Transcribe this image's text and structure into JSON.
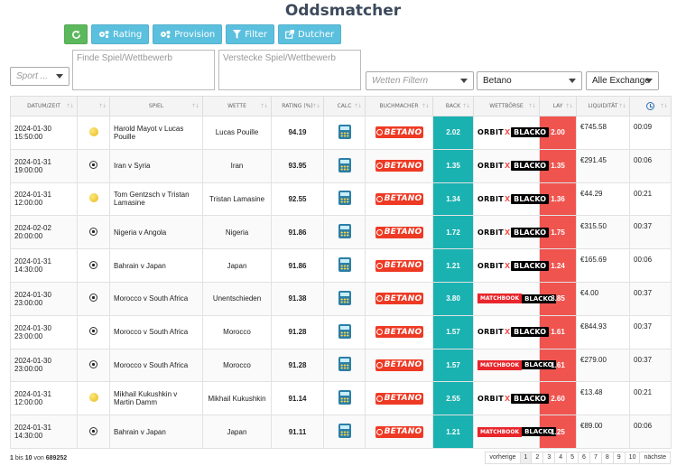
{
  "title": "Oddsmatcher",
  "toolbar": {
    "refresh_icon": "refresh-icon",
    "rating_label": "Rating",
    "provision_label": "Provision",
    "filter_label": "Filter",
    "dutcher_label": "Dutcher"
  },
  "filters": {
    "sport_placeholder": "Sport ...",
    "find_placeholder": "Finde Spiel/Wettbewerb",
    "hide_placeholder": "Verstecke Spiel/Wettbewerb",
    "bets_placeholder": "Wetten Filtern",
    "bookmaker_value": "Betano",
    "exchange_value": "Alle Exchange"
  },
  "table": {
    "headers": {
      "datetime": "Datum/Zeit",
      "spiel": "Spiel",
      "wette": "Wette",
      "rating": "Rating (%)",
      "calc": "Calc",
      "buchmacher": "Buchmacher",
      "back": "Back",
      "wettborse": "Wettbörse",
      "lay": "Lay",
      "liquiditat": "Liquidität"
    },
    "rows": [
      {
        "date": "2024-01-30",
        "time": "15:50:00",
        "sport": "tennis",
        "spiel": "Harold Mayot v Lucas Pouille",
        "wette": "Lucas Pouille",
        "rating": "94.19",
        "bookmaker": "BETANO",
        "back": "2.02",
        "exchange": "orbit",
        "lay": "2.00",
        "liq": "€745.58",
        "age": "00:09"
      },
      {
        "date": "2024-01-31",
        "time": "19:00:00",
        "sport": "football",
        "spiel": "Iran v Syria",
        "wette": "Iran",
        "rating": "93.95",
        "bookmaker": "BETANO",
        "back": "1.35",
        "exchange": "orbit",
        "lay": "1.35",
        "liq": "€291.45",
        "age": "00:06"
      },
      {
        "date": "2024-01-31",
        "time": "12:00:00",
        "sport": "tennis",
        "spiel": "Tom Gentzsch v Tristan Lamasine",
        "wette": "Tristan Lamasine",
        "rating": "92.55",
        "bookmaker": "BETANO",
        "back": "1.34",
        "exchange": "orbit",
        "lay": "1.36",
        "liq": "€44.29",
        "age": "00:21"
      },
      {
        "date": "2024-02-02",
        "time": "20:00:00",
        "sport": "football",
        "spiel": "Nigeria v Angola",
        "wette": "Nigeria",
        "rating": "91.86",
        "bookmaker": "BETANO",
        "back": "1.72",
        "exchange": "orbit",
        "lay": "1.75",
        "liq": "€315.50",
        "age": "00:37"
      },
      {
        "date": "2024-01-31",
        "time": "14:30:00",
        "sport": "football",
        "spiel": "Bahrain v Japan",
        "wette": "Japan",
        "rating": "91.86",
        "bookmaker": "BETANO",
        "back": "1.21",
        "exchange": "orbit",
        "lay": "1.24",
        "liq": "€165.69",
        "age": "00:06"
      },
      {
        "date": "2024-01-30",
        "time": "23:00:00",
        "sport": "football",
        "spiel": "Morocco v South Africa",
        "wette": "Unentschieden",
        "rating": "91.38",
        "bookmaker": "BETANO",
        "back": "3.80",
        "exchange": "matchbook",
        "lay": "3.85",
        "liq": "€4.00",
        "age": "00:37"
      },
      {
        "date": "2024-01-30",
        "time": "23:00:00",
        "sport": "football",
        "spiel": "Morocco v South Africa",
        "wette": "Morocco",
        "rating": "91.28",
        "bookmaker": "BETANO",
        "back": "1.57",
        "exchange": "orbit",
        "lay": "1.61",
        "liq": "€844.93",
        "age": "00:37"
      },
      {
        "date": "2024-01-30",
        "time": "23:00:00",
        "sport": "football",
        "spiel": "Morocco v South Africa",
        "wette": "Morocco",
        "rating": "91.28",
        "bookmaker": "BETANO",
        "back": "1.57",
        "exchange": "matchbook",
        "lay": "1.61",
        "liq": "€279.00",
        "age": "00:37"
      },
      {
        "date": "2024-01-31",
        "time": "12:00:00",
        "sport": "tennis",
        "spiel": "Mikhail Kukushkin v Martin Damm",
        "wette": "Mikhail Kukushkin",
        "rating": "91.14",
        "bookmaker": "BETANO",
        "back": "2.55",
        "exchange": "orbit",
        "lay": "2.60",
        "liq": "€13.48",
        "age": "00:21"
      },
      {
        "date": "2024-01-31",
        "time": "14:30:00",
        "sport": "football",
        "spiel": "Bahrain v Japan",
        "wette": "Japan",
        "rating": "91.11",
        "bookmaker": "BETANO",
        "back": "1.21",
        "exchange": "matchbook",
        "lay": "1.25",
        "liq": "€89.00",
        "age": "00:06"
      }
    ]
  },
  "exchange_logos": {
    "orbit_1": "ORBIT",
    "orbit_x": "X",
    "orbit_2": "BLACK",
    "orbit_2_dot": "O",
    "matchbook_1": "MATCHBOOK",
    "matchbook_2": "BLACK"
  },
  "footer": {
    "from": "1",
    "bis": "bis",
    "to": "10",
    "von": "von",
    "total": "689252",
    "prev": "vorherige",
    "pages": [
      "1",
      "2",
      "3",
      "4",
      "5",
      "6",
      "7",
      "8",
      "9",
      "10"
    ],
    "next": "nächste",
    "active_page": "1"
  },
  "colors": {
    "back": "#1ab1b1",
    "lay": "#f0544f",
    "green_button": "#5cb85c",
    "blue_button": "#5bc0de",
    "betano": "#ee3a24"
  }
}
